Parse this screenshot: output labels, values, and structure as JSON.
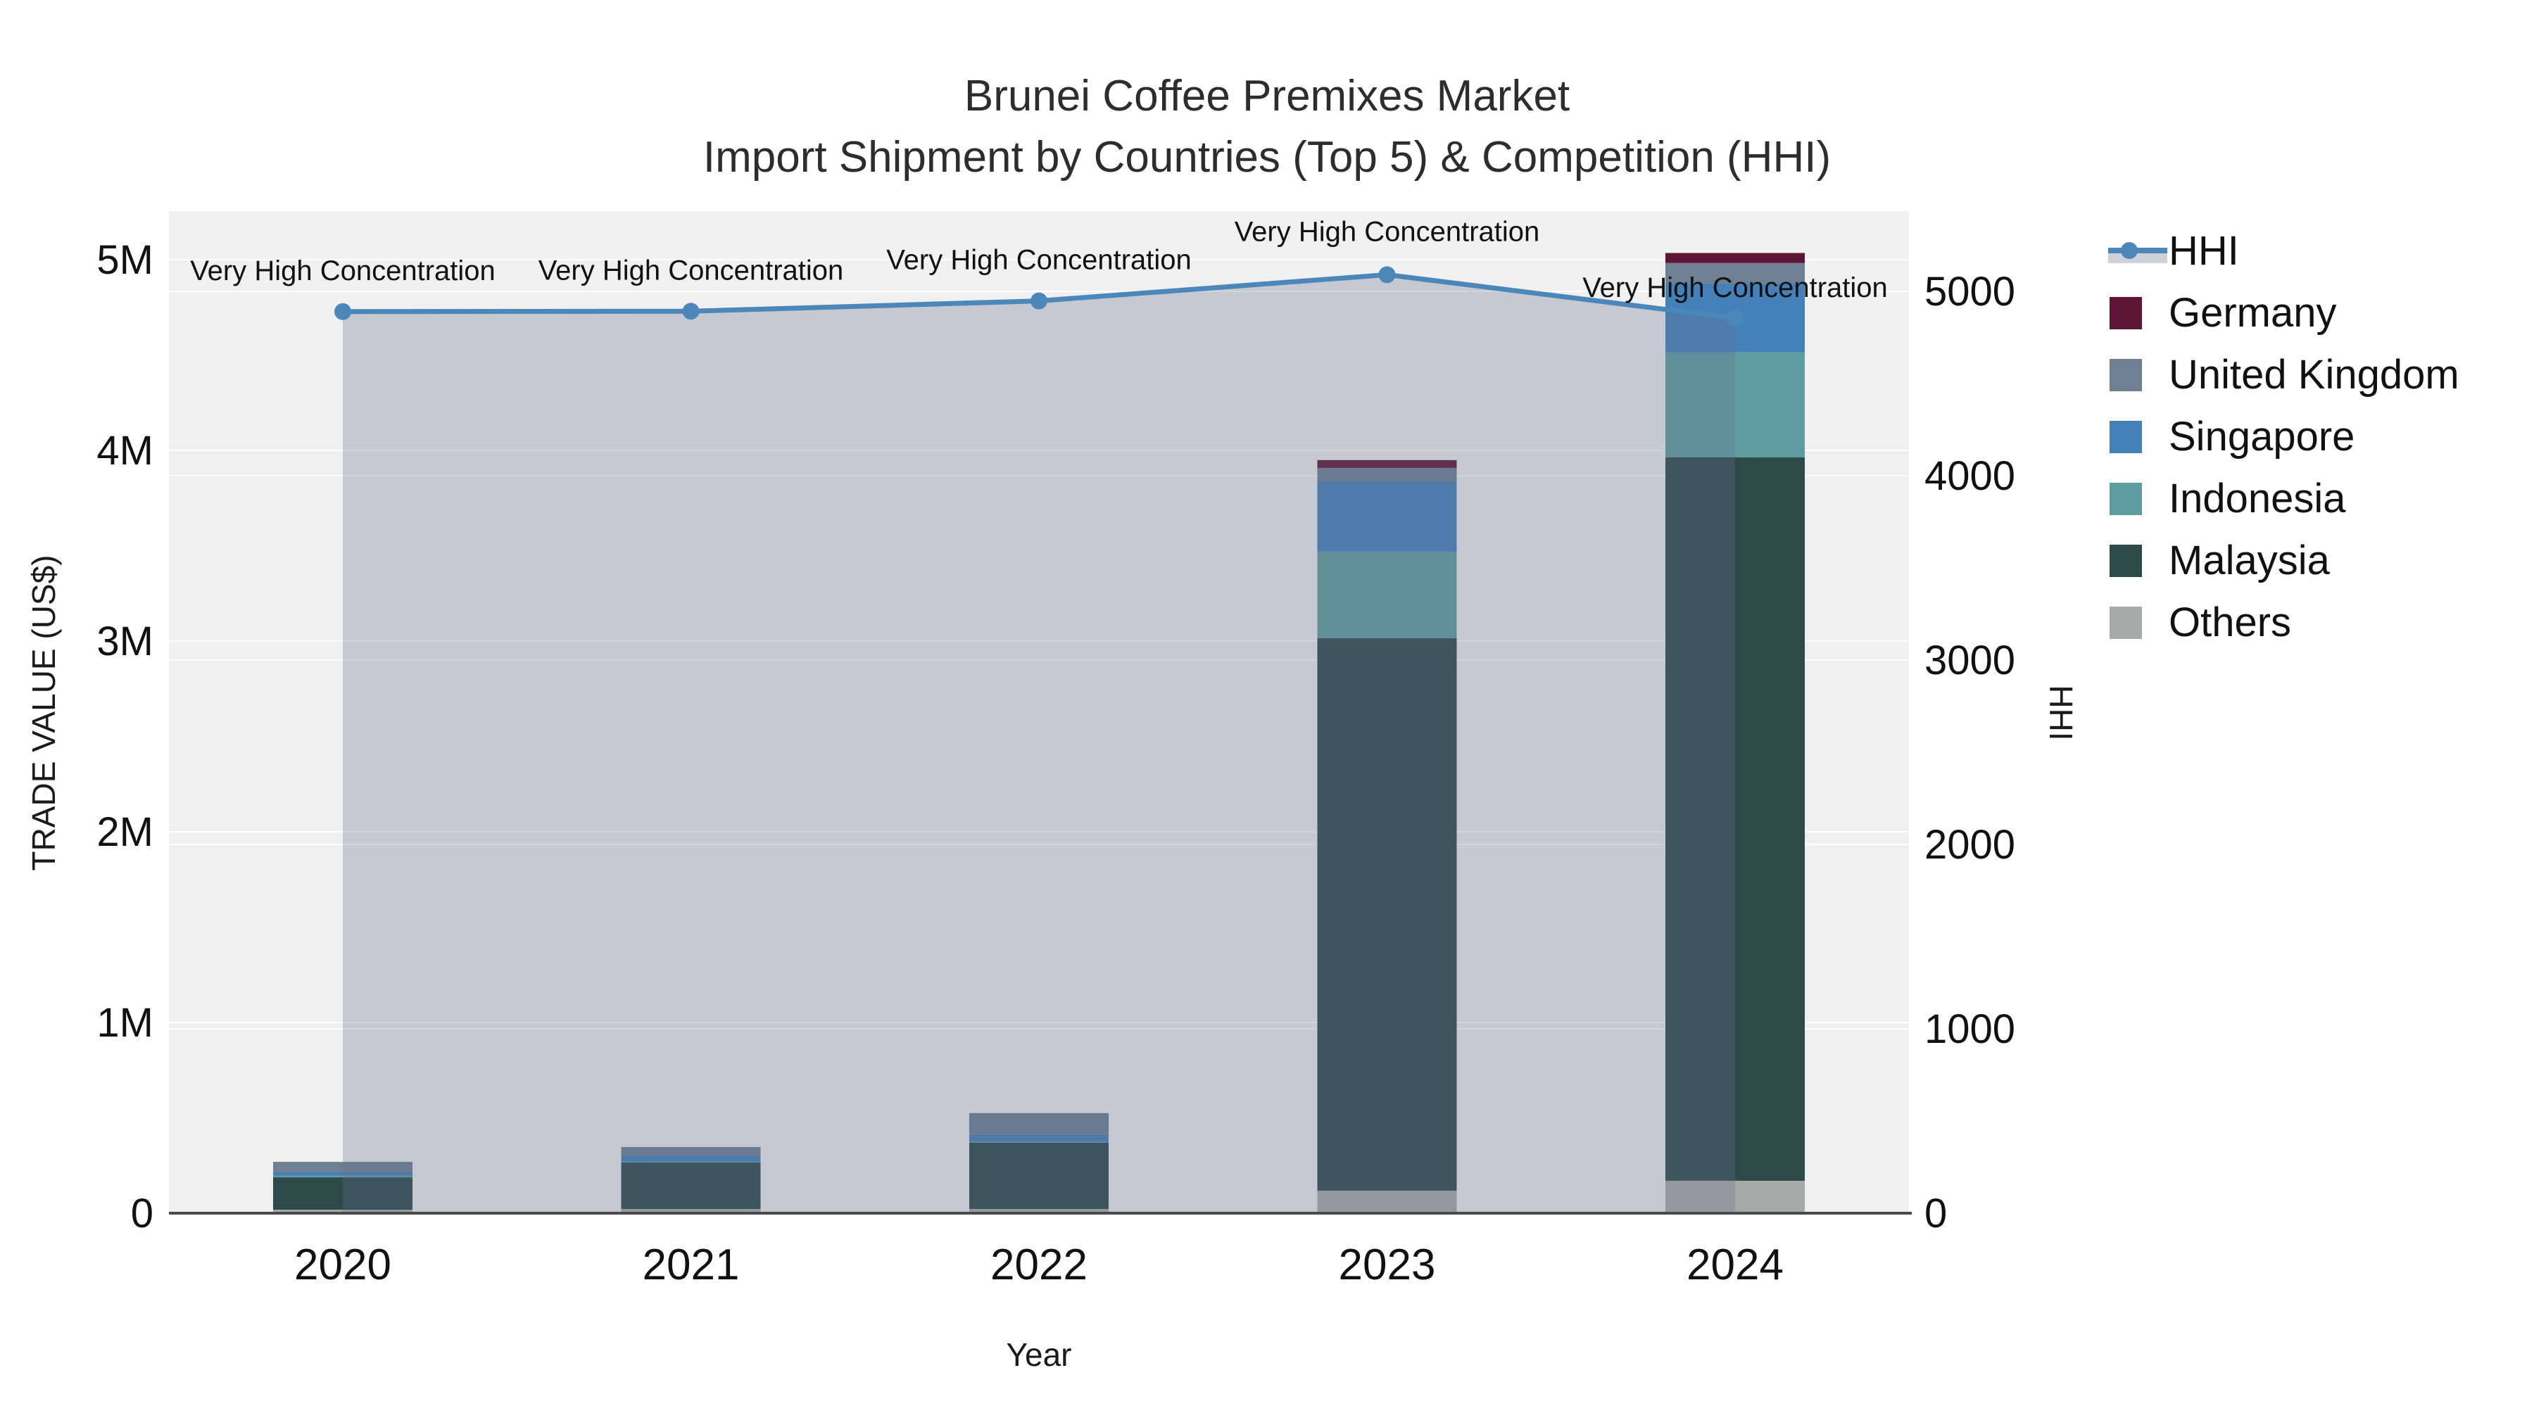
{
  "title": {
    "line1": "Brunei Coffee Premixes Market",
    "line2": "Import Shipment by Countries (Top 5) & Competition (HHI)"
  },
  "axes": {
    "x_title": "Year",
    "y_left_title": "TRADE VALUE (US$)",
    "y_right_title": "HHI",
    "y_left_ticks": [
      "0",
      "1M",
      "2M",
      "3M",
      "4M",
      "5M"
    ],
    "y_right_ticks": [
      "0",
      "1000",
      "2000",
      "3000",
      "4000",
      "5000"
    ]
  },
  "legend": {
    "items": [
      {
        "label": "HHI",
        "type": "line",
        "color": "#4c87b9",
        "band_color": "#ccd1da"
      },
      {
        "label": "Germany",
        "type": "square",
        "color": "#5f1535"
      },
      {
        "label": "United Kingdom",
        "type": "square",
        "color": "#6e7f91"
      },
      {
        "label": "Singapore",
        "type": "square",
        "color": "#4381b8"
      },
      {
        "label": "Indonesia",
        "type": "square",
        "color": "#5d9da0"
      },
      {
        "label": "Malaysia",
        "type": "square",
        "color": "#2d4a48"
      },
      {
        "label": "Others",
        "type": "square",
        "color": "#a8aaa9"
      }
    ]
  },
  "chart_data": {
    "type": "bar",
    "subtype": "stacked-bars-with-line-overlay",
    "categories": [
      "2020",
      "2021",
      "2022",
      "2023",
      "2024"
    ],
    "bar_value_units": "US$ millions",
    "series": [
      {
        "name": "Others",
        "color": "#a8aaa9",
        "values": [
          0.018,
          0.022,
          0.022,
          0.118,
          0.17
        ]
      },
      {
        "name": "Malaysia",
        "color": "#2d4a48",
        "values": [
          0.17,
          0.244,
          0.347,
          2.897,
          3.794
        ]
      },
      {
        "name": "Indonesia",
        "color": "#5d9da0",
        "values": [
          0.008,
          0.004,
          0.004,
          0.454,
          0.55
        ]
      },
      {
        "name": "Singapore",
        "color": "#4381b8",
        "values": [
          0.018,
          0.033,
          0.041,
          0.365,
          0.362
        ]
      },
      {
        "name": "United Kingdom",
        "color": "#6e7f91",
        "values": [
          0.055,
          0.044,
          0.111,
          0.074,
          0.107
        ]
      },
      {
        "name": "Germany",
        "color": "#5f1535",
        "values": [
          0.0,
          0.0,
          0.0,
          0.041,
          0.052
        ]
      }
    ],
    "line_series": {
      "name": "HHI",
      "color": "#4c87b9",
      "fill_color": "#68728f",
      "fill_alpha": 0.3,
      "values": [
        4890,
        4892,
        4948,
        5090,
        4855
      ]
    },
    "annotations": [
      "Very High Concentration",
      "Very High Concentration",
      "Very High Concentration",
      "Very High Concentration",
      "Very High Concentration"
    ],
    "xlabel": "Year",
    "ylabel_left": "TRADE VALUE (US$)",
    "ylabel_right": "HHI",
    "y_left_range_millions": [
      0,
      5.25
    ],
    "y_right_range": [
      0,
      5435
    ],
    "grid": true,
    "legend_position": "right"
  },
  "style": {
    "plot_bg": "#f0f0f0",
    "grid_color": "#ffffff",
    "axis_line_color": "#4a4a4a",
    "tick_color": "#111111",
    "annotation_color": "#111111"
  }
}
